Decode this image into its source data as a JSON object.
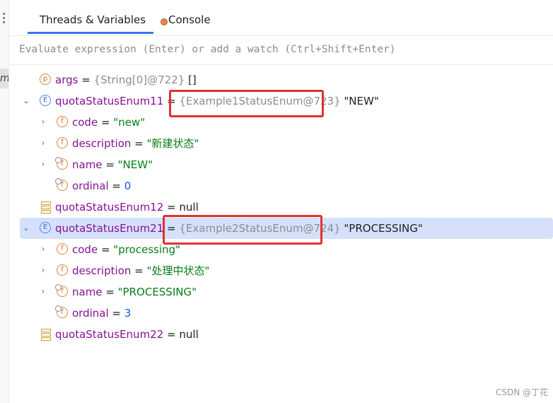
{
  "tabs": [
    {
      "label": "Threads & Variables",
      "active": true
    },
    {
      "label": "Console",
      "active": false
    }
  ],
  "evaluate": {
    "placeholder": "Evaluate expression (Enter) or add a watch (Ctrl+Shift+Enter)",
    "value": ""
  },
  "gutter_marker": "m",
  "variables": [
    {
      "name": "args",
      "eq": " = ",
      "type": "{String[0]@722}",
      "value": " []"
    },
    {
      "name": "quotaStatusEnum11",
      "eq": " = ",
      "type": "{Example1StatusEnum@723}",
      "value": " \"NEW\""
    },
    {
      "name": "code",
      "eq": " = ",
      "value": "\"new\""
    },
    {
      "name": "description",
      "eq": " = ",
      "value": "\"新建状态\""
    },
    {
      "name": "name",
      "eq": " = ",
      "value": "\"NEW\""
    },
    {
      "name": "ordinal",
      "eq": " = ",
      "value": "0"
    },
    {
      "name": "quotaStatusEnum12",
      "eq": " = ",
      "value": "null"
    },
    {
      "name": "quotaStatusEnum21",
      "eq": " = ",
      "type": "{Example2StatusEnum@724}",
      "value": " \"PROCESSING\""
    },
    {
      "name": "code",
      "eq": " = ",
      "value": "\"processing\""
    },
    {
      "name": "description",
      "eq": " = ",
      "value": "\"处理中状态\""
    },
    {
      "name": "name",
      "eq": " = ",
      "value": "\"PROCESSING\""
    },
    {
      "name": "ordinal",
      "eq": " = ",
      "value": "3"
    },
    {
      "name": "quotaStatusEnum22",
      "eq": " = ",
      "value": "null"
    }
  ],
  "icons": {
    "p": "p",
    "e": "E",
    "f": "f"
  },
  "colors": {
    "accent": "#3574f0",
    "highlight_box": "#e0322f",
    "selection": "#d5e1fb",
    "string_value": "#067d17"
  },
  "watermark": "CSDN @丁花"
}
